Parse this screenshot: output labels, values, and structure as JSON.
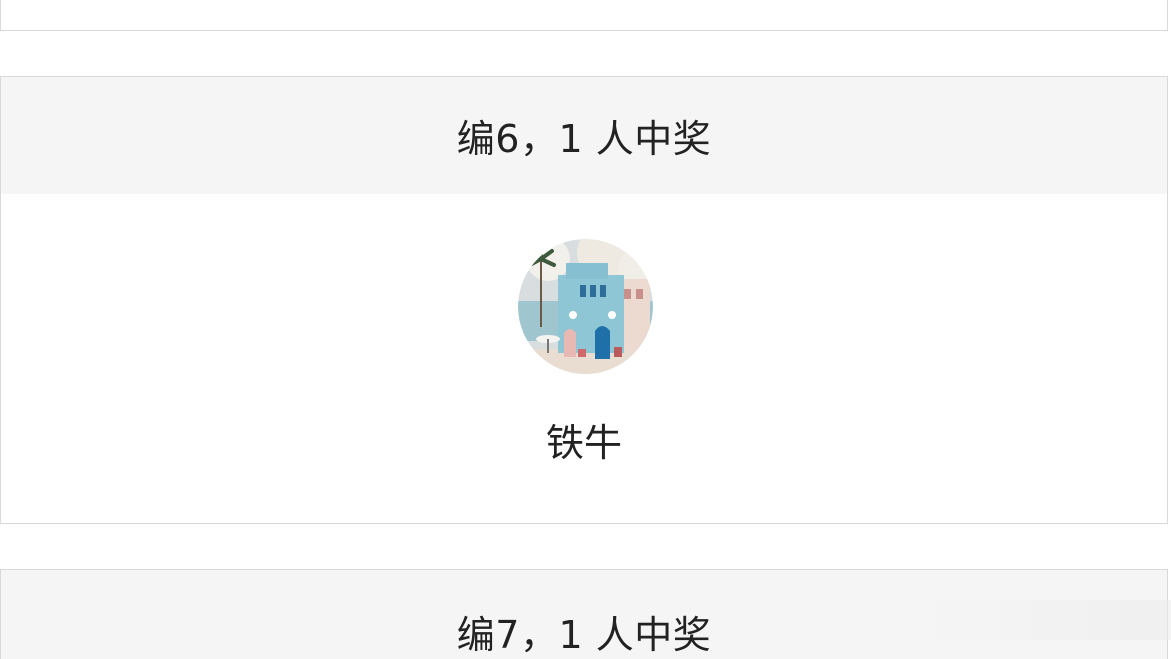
{
  "groups": [
    {
      "title": "编6，1 人中奖",
      "winners": [
        {
          "name": "铁牛",
          "avatar_icon": "house-avatar-icon"
        }
      ]
    },
    {
      "title": "编7，1 人中奖"
    }
  ],
  "colors": {
    "header_bg": "#f5f5f5",
    "border": "#d9d9d9",
    "text": "#222222"
  }
}
